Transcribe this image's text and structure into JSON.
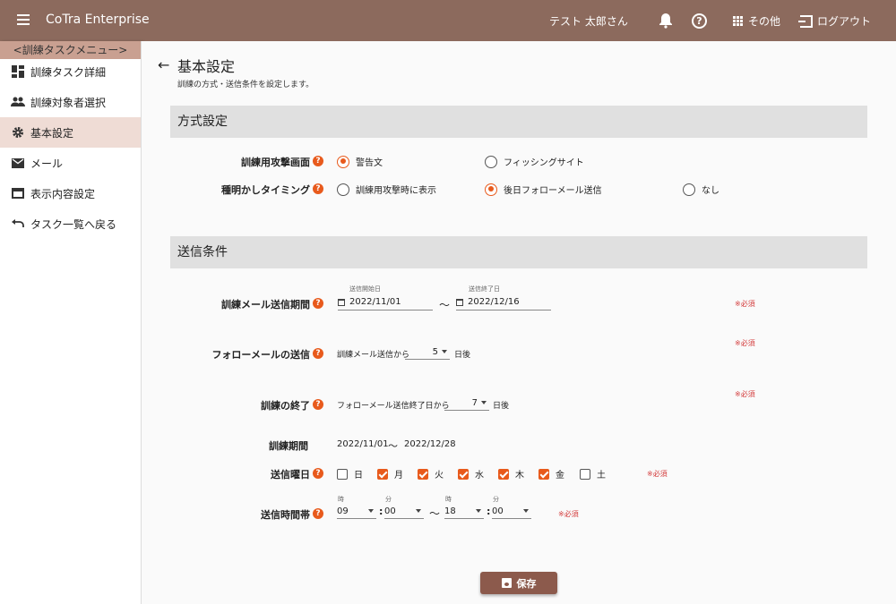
{
  "app": {
    "title": "CoTra Enterprise"
  },
  "header": {
    "user": "テスト 太郎さん",
    "more": "その他",
    "logout": "ログアウト"
  },
  "sidebar": {
    "header": "<訓練タスクメニュー>",
    "items": [
      {
        "label": "訓練タスク詳細",
        "icon": "dashboard-icon"
      },
      {
        "label": "訓練対象者選択",
        "icon": "people-icon"
      },
      {
        "label": "基本設定",
        "icon": "gear-icon",
        "active": true
      },
      {
        "label": "メール",
        "icon": "mail-icon"
      },
      {
        "label": "表示内容設定",
        "icon": "window-icon"
      },
      {
        "label": "タスク一覧へ戻る",
        "icon": "undo-icon"
      }
    ]
  },
  "page": {
    "title": "基本設定",
    "subtitle": "訓練の方式・送信条件を設定します。"
  },
  "method": {
    "section_title": "方式設定",
    "attack_screen": {
      "label": "訓練用攻撃画面",
      "options": [
        "警告文",
        "フィッシングサイト"
      ],
      "selected": "警告文"
    },
    "reveal_timing": {
      "label": "種明かしタイミング",
      "options": [
        "訓練用攻撃時に表示",
        "後日フォローメール送信",
        "なし"
      ],
      "selected": "後日フォローメール送信"
    }
  },
  "conditions": {
    "section_title": "送信条件",
    "required": "※必須",
    "send_period": {
      "label": "訓練メール送信期間",
      "start_label": "送信開始日",
      "start": "2022/11/01",
      "end_label": "送信終了日",
      "end": "2022/12/16",
      "tilde": "～"
    },
    "followup": {
      "label": "フォローメールの送信",
      "prefix": "訓練メール送信から",
      "value": "5",
      "suffix": "日後"
    },
    "end": {
      "label": "訓練の終了",
      "prefix": "フォローメール送信終了日から",
      "value": "7",
      "suffix": "日後"
    },
    "period": {
      "label": "訓練期間",
      "start": "2022/11/01",
      "tilde": "～",
      "end": "2022/12/28"
    },
    "weekdays": {
      "label": "送信曜日",
      "days": [
        {
          "label": "日",
          "checked": false
        },
        {
          "label": "月",
          "checked": true
        },
        {
          "label": "火",
          "checked": true
        },
        {
          "label": "水",
          "checked": true
        },
        {
          "label": "木",
          "checked": true
        },
        {
          "label": "金",
          "checked": true
        },
        {
          "label": "土",
          "checked": false
        }
      ]
    },
    "time_range": {
      "label": "送信時間帯",
      "hour_label": "時",
      "minute_label": "分",
      "start_hour": "09",
      "start_minute": "00",
      "end_hour": "18",
      "end_minute": "00",
      "colon": ":",
      "tilde": "～"
    }
  },
  "actions": {
    "save": "保存"
  },
  "help_glyph": "?",
  "colors": {
    "header": "#8c6a5d",
    "accent": "#e85a1c",
    "save": "#8c5a4c",
    "sidebar_active": "#efdcd5"
  }
}
